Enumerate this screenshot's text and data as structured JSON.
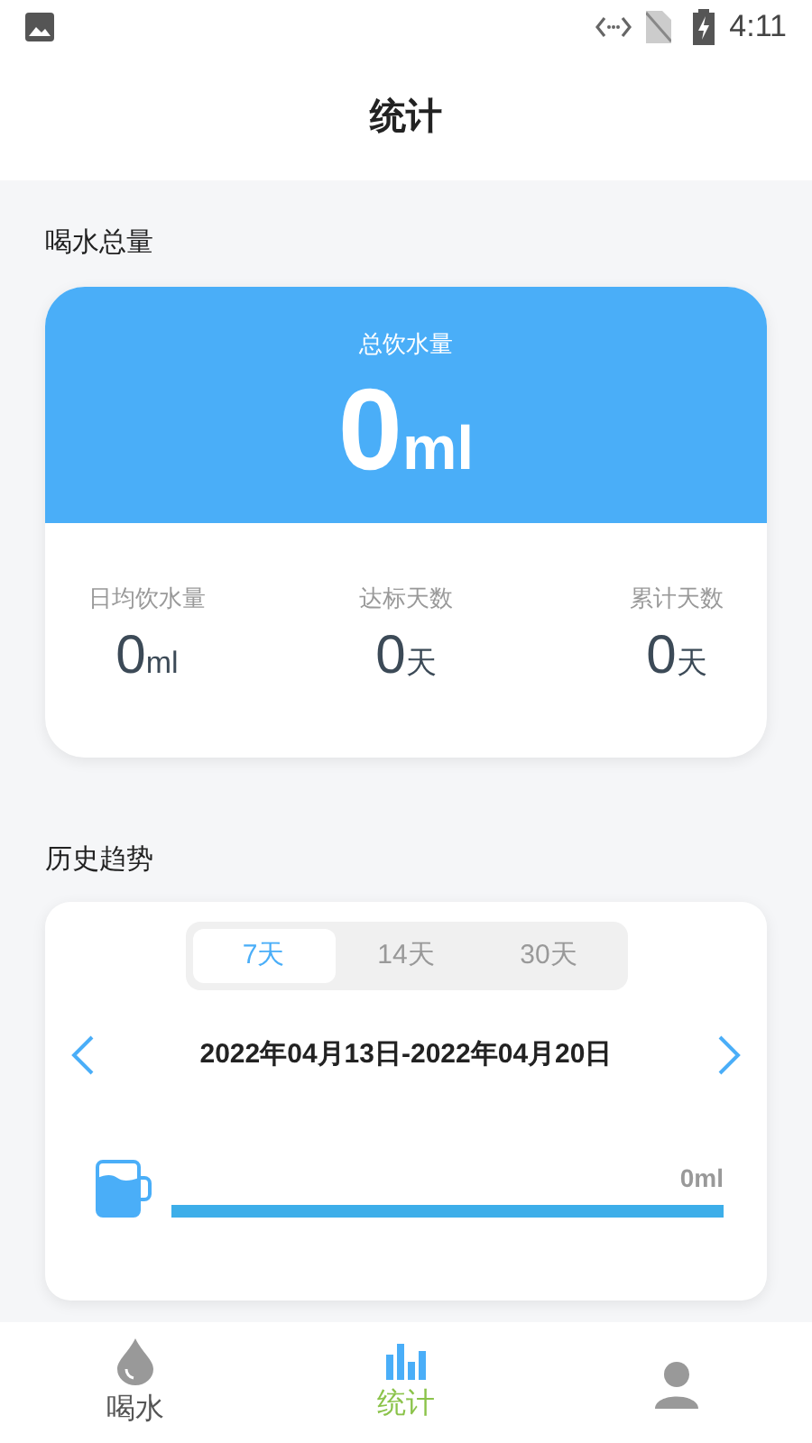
{
  "status_bar": {
    "time": "4:11"
  },
  "header": {
    "title": "统计"
  },
  "total_section": {
    "title": "喝水总量",
    "label": "总饮水量",
    "value": "0",
    "unit": "ml",
    "stats": [
      {
        "label": "日均饮水量",
        "value": "0",
        "unit": "ml"
      },
      {
        "label": "达标天数",
        "value": "0",
        "unit": "天"
      },
      {
        "label": "累计天数",
        "value": "0",
        "unit": "天"
      }
    ]
  },
  "history_section": {
    "title": "历史趋势",
    "tabs": [
      {
        "label": "7天",
        "selected": true
      },
      {
        "label": "14天",
        "selected": false
      },
      {
        "label": "30天",
        "selected": false
      }
    ],
    "date_range": "2022年04月13日-2022年04月20日",
    "amount": "0ml"
  },
  "bottom_nav": [
    {
      "kind": "drop",
      "label": "喝水",
      "selected": false
    },
    {
      "kind": "chart",
      "label": "统计",
      "selected": true
    },
    {
      "kind": "person",
      "selected": false
    }
  ]
}
